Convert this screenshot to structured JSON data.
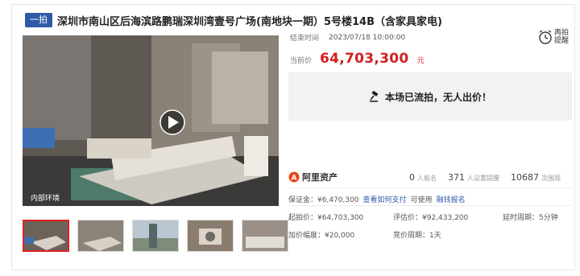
{
  "header": {
    "tag": "一拍",
    "title": "深圳市南山区后海滨路鹏瑞深圳湾壹号广场(南地块一期）5号楼14B（含家具家电)"
  },
  "gallery": {
    "main_caption": "内部环境",
    "thumbnails": [
      "thumb-1",
      "thumb-2",
      "thumb-3",
      "thumb-4",
      "thumb-5"
    ]
  },
  "auction": {
    "end_label": "结束时间",
    "end_time": "2023/07/18 10:00:00",
    "price_label": "当前价",
    "price": "64,703,300",
    "price_unit": "元",
    "remind_label": "再拍提醒",
    "status": "本场已流拍，无人出价！"
  },
  "stats": {
    "brand": "阿里资产",
    "signups_n": "0",
    "signups_l": "人报名",
    "reminders_n": "371",
    "reminders_l": "人设置提醒",
    "views_n": "10687",
    "views_l": "次围观"
  },
  "deposit": {
    "label": "保证金：¥6,470,300",
    "how_to_pay": "查看如何支付",
    "can_use": "可使用",
    "bank": "融钱报名"
  },
  "details": {
    "start_price": "起拍价：¥64,703,300",
    "appraisal": "评估价：¥92,433,200",
    "delay": "延时周期：5分钟",
    "increment": "加价幅度：¥20,000",
    "cycle": "竞价周期：1天"
  },
  "colors": {
    "accent_blue": "#2f5aa8",
    "price_red": "#d11f1f",
    "status_bg": "#f2f2f2"
  }
}
